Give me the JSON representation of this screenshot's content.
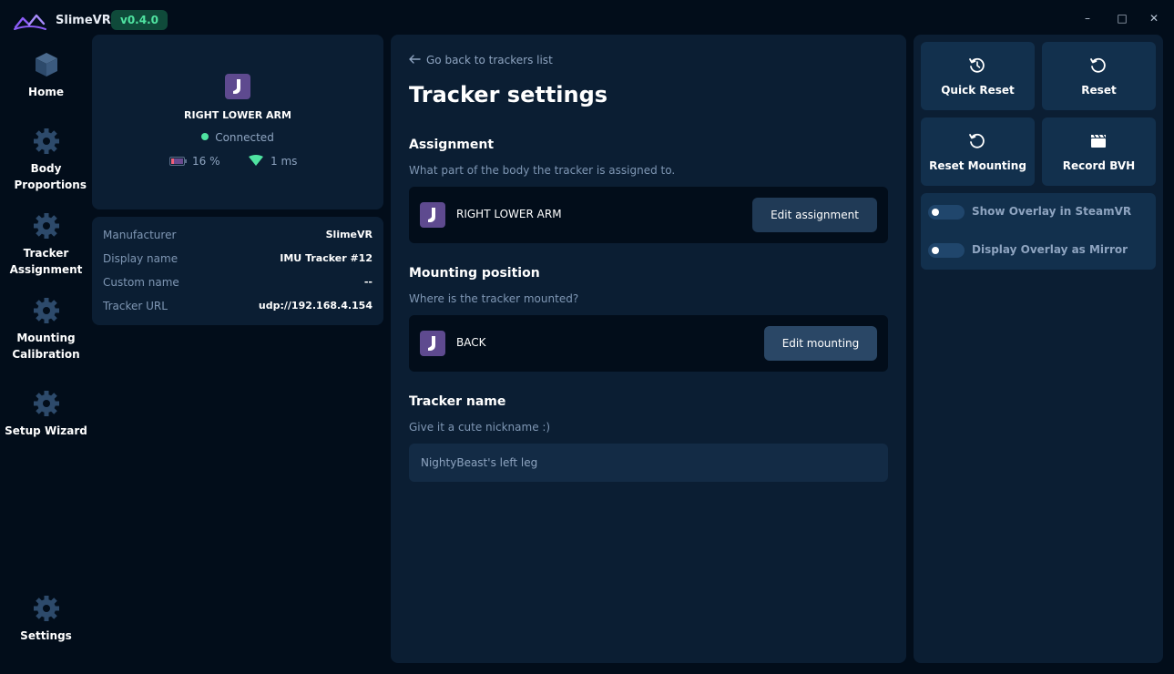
{
  "app": {
    "name": "SlimeVR",
    "version": "v0.4.0",
    "window_controls": {
      "minimize": "–",
      "maximize": "□",
      "close": "✕"
    }
  },
  "colors": {
    "background": "#020d1a",
    "card": "#0b1e33",
    "button": "#203a56",
    "accent_purple": "#5e4a8f",
    "connected_green": "#4fe3a1"
  },
  "nav": {
    "items": [
      {
        "label": "Home",
        "icon": "cube-icon"
      },
      {
        "label": "Body Proportions",
        "icon": "gear-icon"
      },
      {
        "label": "Tracker Assignment",
        "icon": "gear-icon"
      },
      {
        "label": "Mounting Calibration",
        "icon": "gear-icon"
      },
      {
        "label": "Setup Wizard",
        "icon": "gear-icon"
      },
      {
        "label": "Settings",
        "icon": "gear-icon"
      }
    ]
  },
  "tracker": {
    "body_part": "RIGHT LOWER ARM",
    "status": "Connected",
    "battery": "16 %",
    "ping": "1 ms",
    "icon": "foot-icon"
  },
  "info": {
    "rows": [
      {
        "key": "Manufacturer",
        "value": "SlimeVR"
      },
      {
        "key": "Display name",
        "value": "IMU Tracker #12"
      },
      {
        "key": "Custom name",
        "value": "--"
      },
      {
        "key": "Tracker URL",
        "value": "udp://192.168.4.154"
      }
    ]
  },
  "settings": {
    "back_label": "Go back to trackers list",
    "title": "Tracker settings",
    "assignment": {
      "title": "Assignment",
      "description": "What part of the body the tracker is assigned to.",
      "value": "RIGHT LOWER ARM",
      "button": "Edit assignment"
    },
    "mounting": {
      "title": "Mounting position",
      "description": "Where is the tracker mounted?",
      "value": "BACK",
      "button": "Edit mounting"
    },
    "name": {
      "title": "Tracker name",
      "description": "Give it a cute nickname :)",
      "placeholder": "NightyBeast's left leg"
    }
  },
  "actions": {
    "quick_reset": "Quick Reset",
    "reset": "Reset",
    "reset_mounting": "Reset Mounting",
    "record_bvh": "Record BVH"
  },
  "overlay": {
    "show_steamvr": {
      "label": "Show Overlay in SteamVR",
      "on": false
    },
    "mirror": {
      "label": "Display Overlay as Mirror",
      "on": false
    }
  }
}
